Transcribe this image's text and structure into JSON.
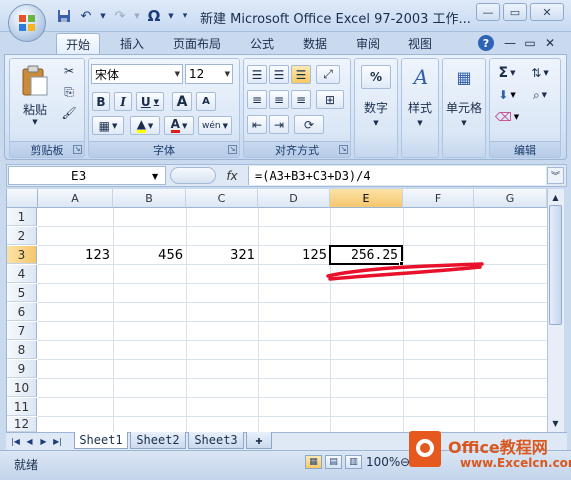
{
  "window": {
    "title": "新建 Microsoft Office Excel 97-2003 工作...",
    "controls": [
      "minimize",
      "maximize",
      "close"
    ]
  },
  "qat": {
    "icons": [
      "save-icon",
      "undo-icon",
      "redo-icon",
      "omega-icon",
      "customize-icon"
    ],
    "omega_label": "Ω"
  },
  "tabs": [
    {
      "label": "开始",
      "active": true
    },
    {
      "label": "插入"
    },
    {
      "label": "页面布局"
    },
    {
      "label": "公式"
    },
    {
      "label": "数据"
    },
    {
      "label": "审阅"
    },
    {
      "label": "视图"
    }
  ],
  "ribbon": {
    "clipboard": {
      "label": "剪贴板",
      "paste_label": "粘贴"
    },
    "font": {
      "label": "字体",
      "font_name": "宋体",
      "font_size": "12",
      "bold": "B",
      "italic": "I",
      "underline": "U",
      "grow": "A",
      "shrink": "A",
      "font_color_letter": "A",
      "phonetic": "wén"
    },
    "alignment": {
      "label": "对齐方式"
    },
    "number": {
      "label": "数字",
      "percent": "%"
    },
    "styles": {
      "label": "样式"
    },
    "cells": {
      "label": "单元格"
    },
    "editing": {
      "label": "编辑"
    }
  },
  "formula_bar": {
    "name_box": "E3",
    "fx": "fx",
    "formula": "=(A3+B3+C3+D3)/4"
  },
  "grid": {
    "columns": [
      "A",
      "B",
      "C",
      "D",
      "E",
      "F",
      "G"
    ],
    "selected_column": "E",
    "rows": [
      "1",
      "2",
      "3",
      "4",
      "5",
      "6",
      "7",
      "8",
      "9",
      "10",
      "11",
      "12"
    ],
    "selected_row": "3",
    "row3": {
      "A": "123",
      "B": "456",
      "C": "321",
      "D": "125",
      "E": "256.25"
    },
    "annotation_color": "#e8102a"
  },
  "sheets": [
    "Sheet1",
    "Sheet2",
    "Sheet3"
  ],
  "active_sheet": "Sheet1",
  "status": {
    "text": "就绪",
    "zoom": "100%"
  },
  "watermark": {
    "main": "Office教程网",
    "site": "www.Excelcn.com",
    "color": "#d9581f"
  }
}
